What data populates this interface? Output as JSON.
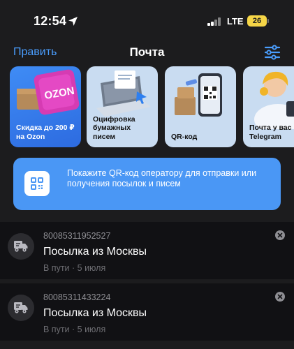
{
  "status_bar": {
    "time": "12:54",
    "network": "LTE",
    "battery": "26"
  },
  "nav": {
    "edit": "Править",
    "title": "Почта",
    "accent_color": "#4a9eff"
  },
  "promo_cards": [
    {
      "label": "Скидка до 200 ₽ на Ozon",
      "brand_text": "OZON"
    },
    {
      "label": "Оцифровка бумажных писем"
    },
    {
      "label": "QR-код"
    },
    {
      "label": "Почта у вас в Telegram"
    }
  ],
  "banner": {
    "text": "Покажите QR-код оператору для отправки или получения посылок и писем",
    "color": "#4a97f5"
  },
  "parcels": [
    {
      "number": "80085311952527",
      "title": "Посылка из Москвы",
      "status": "В пути · 5 июля"
    },
    {
      "number": "80085311433224",
      "title": "Посылка из Москвы",
      "status": "В пути · 5 июля"
    }
  ]
}
